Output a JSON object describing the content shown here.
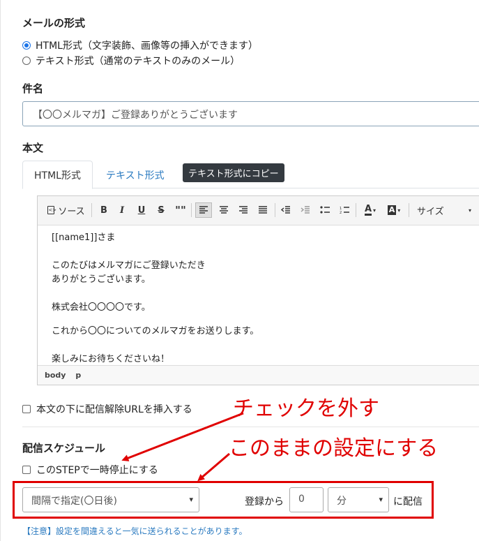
{
  "mail_format": {
    "heading": "メールの形式",
    "options": [
      {
        "label": "HTML形式（文字装飾、画像等の挿入ができます）",
        "selected": true
      },
      {
        "label": "テキスト形式（通常のテキストのみのメール）",
        "selected": false
      }
    ]
  },
  "subject": {
    "heading": "件名",
    "value": "【〇〇メルマガ】ご登録ありがとうございます"
  },
  "body": {
    "heading": "本文",
    "tabs": [
      {
        "label": "HTML形式",
        "active": true
      },
      {
        "label": "テキスト形式",
        "active": false
      }
    ],
    "copy_tooltip": "テキスト形式にコピー",
    "toolbar": {
      "source_label": "ソース",
      "bold": "B",
      "italic": "I",
      "underline": "U",
      "strike": "S",
      "quote": "\"\"",
      "size_label": "サイズ",
      "icons": [
        "source-icon",
        "bold-icon",
        "italic-icon",
        "underline-icon",
        "strikethrough-icon",
        "blockquote-icon",
        "align-left-icon",
        "align-center-icon",
        "align-right-icon",
        "align-justify-icon",
        "indent-decrease-icon",
        "indent-increase-icon",
        "bulleted-list-icon",
        "numbered-list-icon",
        "text-color-icon",
        "background-color-icon"
      ]
    },
    "content_lines": [
      "[[name1]]さま",
      "",
      "このたびはメルマガにご登録いただき",
      "ありがとうございます。",
      "",
      "株式会社〇〇〇〇です。",
      "",
      "これから〇〇についてのメルマガをお送りします。",
      "",
      "楽しみにお待ちくださいね！"
    ],
    "statusbar": {
      "path1": "body",
      "path2": "p"
    }
  },
  "unsubscribe_checkbox": {
    "label": "本文の下に配信解除URLを挿入する",
    "checked": false
  },
  "schedule": {
    "heading": "配信スケジュール",
    "pause_checkbox": {
      "label": "このSTEPで一時停止にする",
      "checked": false
    },
    "interval_select": "間隔で指定(〇日後)",
    "from_label": "登録から",
    "amount_value": "0",
    "unit_select": "分",
    "deliver_label": "に配信",
    "note": "【注意】設定を間違えると一気に送られることがあります。"
  },
  "annotations": {
    "uncheck": "チェックを外す",
    "keep_setting": "このままの設定にする",
    "color": "#e00000"
  }
}
